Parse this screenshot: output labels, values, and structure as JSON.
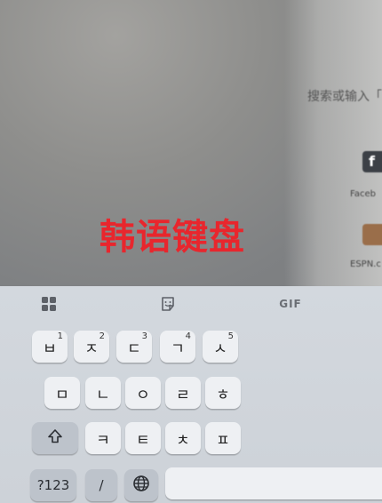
{
  "background": {
    "search_hint": "搜索或输入「",
    "sites": [
      {
        "icon": "facebook-icon",
        "glyph": "f",
        "label": "Faceb"
      },
      {
        "icon": "espn-icon",
        "glyph": "",
        "label": "ESPN.c"
      }
    ]
  },
  "overlay": {
    "title": "韩语键盘",
    "color": "#e8262d"
  },
  "keyboard": {
    "toolbar": {
      "apps_icon": "grid-apps-icon",
      "sticker_icon": "sticker-icon",
      "gif_label": "GIF"
    },
    "row1": [
      {
        "char": "ㅂ",
        "hint": "1"
      },
      {
        "char": "ㅈ",
        "hint": "2"
      },
      {
        "char": "ㄷ",
        "hint": "3"
      },
      {
        "char": "ㄱ",
        "hint": "4"
      },
      {
        "char": "ㅅ",
        "hint": "5"
      }
    ],
    "row2": [
      {
        "char": "ㅁ"
      },
      {
        "char": "ㄴ"
      },
      {
        "char": "ㅇ"
      },
      {
        "char": "ㄹ"
      },
      {
        "char": "ㅎ"
      }
    ],
    "row3": [
      {
        "char": "ㅋ"
      },
      {
        "char": "ㅌ"
      },
      {
        "char": "ㅊ"
      },
      {
        "char": "ㅍ"
      }
    ],
    "shift_icon": "shift-icon",
    "symbols_label": "?123",
    "slash_label": "/",
    "globe_icon": "globe-icon"
  }
}
